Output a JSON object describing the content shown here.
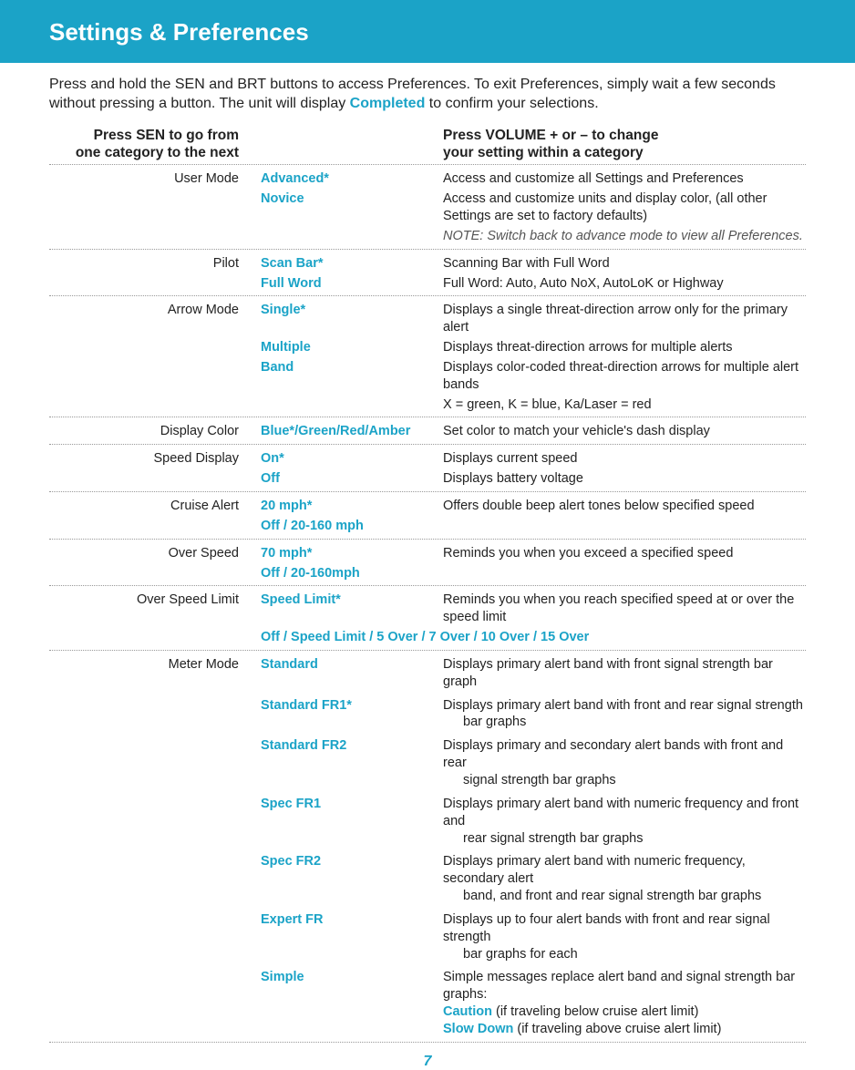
{
  "title": "Settings & Preferences",
  "intro_parts": {
    "p1": "Press and hold the SEN and BRT buttons to access Preferences. To exit Preferences, simply wait a few seconds without pressing a button. The unit will display ",
    "completed": "Completed",
    "p2": " to confirm your selections."
  },
  "header_left_l1": "Press SEN to go from",
  "header_left_l2": "one category to the next",
  "header_right_l1": "Press VOLUME + or – to change",
  "header_right_l2": "your setting within a category",
  "usermode_label": "User Mode",
  "usermode_o1": "Advanced*",
  "usermode_d1": "Access and customize all Settings and Preferences",
  "usermode_o2": "Novice",
  "usermode_d2": "Access and customize units and display color, (all other Settings are set to factory defaults)",
  "usermode_note": "NOTE: Switch back to advance mode to view all Preferences.",
  "pilot_label": "Pilot",
  "pilot_o1": "Scan Bar*",
  "pilot_d1": "Scanning Bar with Full Word",
  "pilot_o2": "Full Word",
  "pilot_d2": "Full Word: Auto, Auto NoX, AutoLoK or Highway",
  "arrow_label": "Arrow Mode",
  "arrow_o1": "Single*",
  "arrow_d1": "Displays a single threat-direction arrow only for the primary alert",
  "arrow_o2": "Multiple",
  "arrow_d2": "Displays threat-direction arrows for multiple alerts",
  "arrow_o3": "Band",
  "arrow_d3": "Displays color-coded threat-direction arrows for multiple alert bands",
  "arrow_d4": "X = green, K = blue, Ka/Laser = red",
  "dispcolor_label": "Display Color",
  "dispcolor_o": "Blue*/Green/Red/Amber",
  "dispcolor_d": "Set color to match your vehicle's dash display",
  "speeddisp_label": "Speed Display",
  "speeddisp_o1": "On*",
  "speeddisp_d1": "Displays current speed",
  "speeddisp_o2": "Off",
  "speeddisp_d2": "Displays battery voltage",
  "cruise_label": "Cruise Alert",
  "cruise_o1": "20 mph*",
  "cruise_d1": "Offers double beep alert tones below specified speed",
  "cruise_o2": "Off / 20-160 mph",
  "overspeed_label": "Over Speed",
  "overspeed_o1": "70 mph*",
  "overspeed_d1": "Reminds you when you exceed a specified speed",
  "overspeed_o2": "Off / 20-160mph",
  "osl_label": "Over Speed Limit",
  "osl_o1": "Speed Limit*",
  "osl_d1": "Reminds you when you reach specified speed at or over the speed limit",
  "osl_o2": "Off / Speed Limit / 5 Over / 7 Over / 10 Over / 15 Over",
  "meter_label": "Meter Mode",
  "meter_o1": "Standard",
  "meter_d1": "Displays primary alert band with front signal strength bar graph",
  "meter_o2": "Standard FR1*",
  "meter_d2a": "Displays primary alert band with front and rear signal strength",
  "meter_d2b": "bar graphs",
  "meter_o3": "Standard FR2",
  "meter_d3a": "Displays primary and secondary alert bands with front and rear",
  "meter_d3b": "signal strength bar graphs",
  "meter_o4": "Spec FR1",
  "meter_d4a": "Displays primary alert band with numeric frequency and front and",
  "meter_d4b": "rear signal strength bar graphs",
  "meter_o5": "Spec FR2",
  "meter_d5a": "Displays primary alert band with numeric frequency, secondary alert",
  "meter_d5b": "band, and front and rear signal strength bar graphs",
  "meter_o6": "Expert FR",
  "meter_d6a": "Displays up to four alert bands with front and rear signal strength",
  "meter_d6b": "bar graphs for each",
  "meter_o7": "Simple",
  "meter_d7a": "Simple messages replace alert band and signal strength  bar graphs:",
  "meter_d7b_accent": "Caution",
  "meter_d7b_rest": " (if traveling below cruise alert limit)",
  "meter_d7c_accent": "Slow Down",
  "meter_d7c_rest": " (if traveling above cruise alert limit)",
  "page_number": "7"
}
